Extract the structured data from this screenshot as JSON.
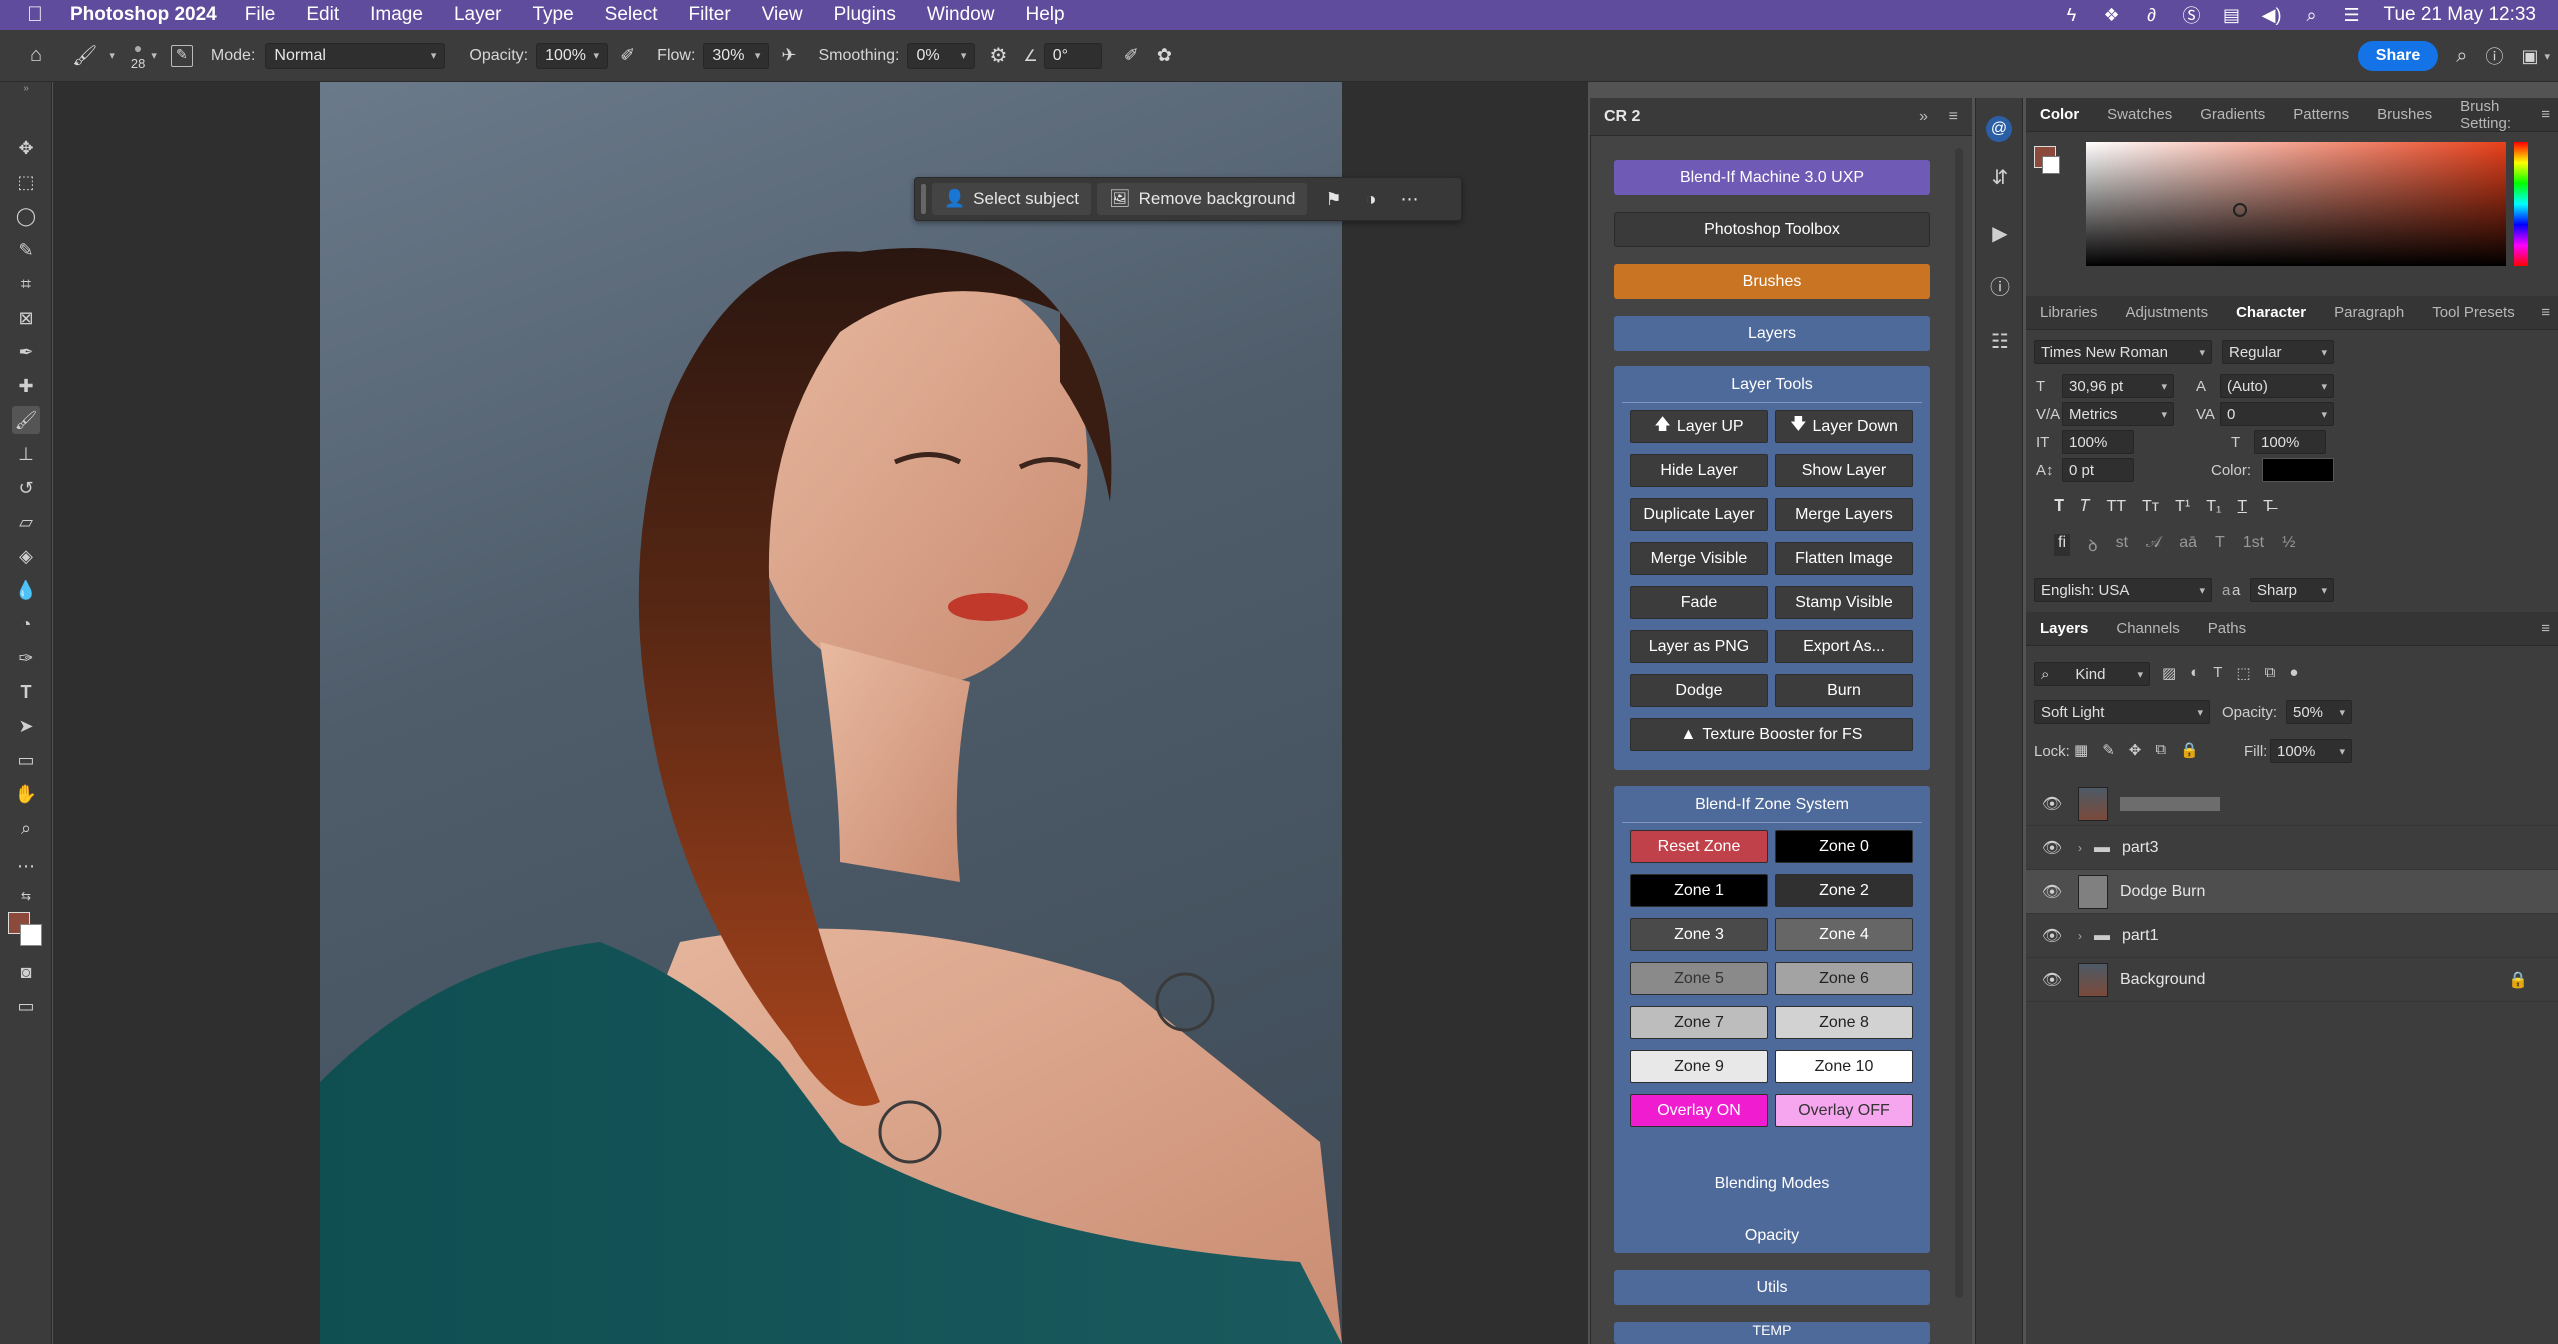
{
  "menubar": {
    "app": "Photoshop 2024",
    "items": [
      "File",
      "Edit",
      "Image",
      "Layer",
      "Type",
      "Select",
      "Filter",
      "View",
      "Plugins",
      "Window",
      "Help"
    ],
    "clock": "Tue 21 May  12:33"
  },
  "options": {
    "brush_size": "28",
    "mode_label": "Mode:",
    "mode_value": "Normal",
    "opacity_label": "Opacity:",
    "opacity_value": "100%",
    "flow_label": "Flow:",
    "flow_value": "30%",
    "smoothing_label": "Smoothing:",
    "smoothing_value": "0%",
    "angle_value": "0°",
    "share": "Share"
  },
  "taskbar": {
    "select_subject": "Select subject",
    "remove_background": "Remove background"
  },
  "cr2": {
    "title": "CR 2",
    "blendif_machine": "Blend-If Machine 3.0 UXP",
    "toolbox": "Photoshop Toolbox",
    "brushes": "Brushes",
    "layers": "Layers",
    "layer_tools_title": "Layer Tools",
    "layer_tools": [
      "Layer UP",
      "Layer Down",
      "Hide Layer",
      "Show Layer",
      "Duplicate Layer",
      "Merge Layers",
      "Merge Visible",
      "Flatten Image",
      "Fade",
      "Stamp Visible",
      "Layer as PNG",
      "Export As...",
      "Dodge",
      "Burn"
    ],
    "texture_booster": "Texture Booster for FS",
    "zone_title": "Blend-If Zone System",
    "zones": [
      "Reset Zone",
      "Zone 0",
      "Zone 1",
      "Zone 2",
      "Zone 3",
      "Zone 4",
      "Zone 5",
      "Zone 6",
      "Zone 7",
      "Zone 8",
      "Zone 9",
      "Zone 10",
      "Overlay ON",
      "Overlay OFF"
    ],
    "blending_modes": "Blending Modes",
    "opacity": "Opacity",
    "utils": "Utils",
    "temp": "TEMP"
  },
  "color_tabs": [
    "Color",
    "Swatches",
    "Gradients",
    "Patterns",
    "Brushes",
    "Brush Setting:"
  ],
  "char_tabs": [
    "Libraries",
    "Adjustments",
    "Character",
    "Paragraph",
    "Tool Presets"
  ],
  "character": {
    "font": "Times New Roman",
    "style": "Regular",
    "size": "30,96 pt",
    "leading": "(Auto)",
    "kerning": "Metrics",
    "tracking": "0",
    "vscale": "100%",
    "hscale": "100%",
    "baseline": "0 pt",
    "color_label": "Color:",
    "language": "English: USA",
    "aa_label": "a",
    "antialias": "Sharp"
  },
  "layers_tabs": [
    "Layers",
    "Channels",
    "Paths"
  ],
  "layers_panel": {
    "kind": "Kind",
    "blend": "Soft Light",
    "opacity_label": "Opacity:",
    "opacity": "50%",
    "lock_label": "Lock:",
    "fill_label": "Fill:",
    "fill": "100%",
    "layers": [
      {
        "name": ""
      },
      {
        "name": "part3"
      },
      {
        "name": "Dodge Burn"
      },
      {
        "name": "part1"
      },
      {
        "name": "Background"
      }
    ]
  },
  "colors": {
    "accent_purple": "#6f5bb6",
    "brushes_orange": "#c87422",
    "blue": "#4e6a9a",
    "reset_red": "#c0414a",
    "overlay_on": "#f01cd0",
    "overlay_off": "#f5a6ee",
    "share_blue": "#1473e6"
  }
}
